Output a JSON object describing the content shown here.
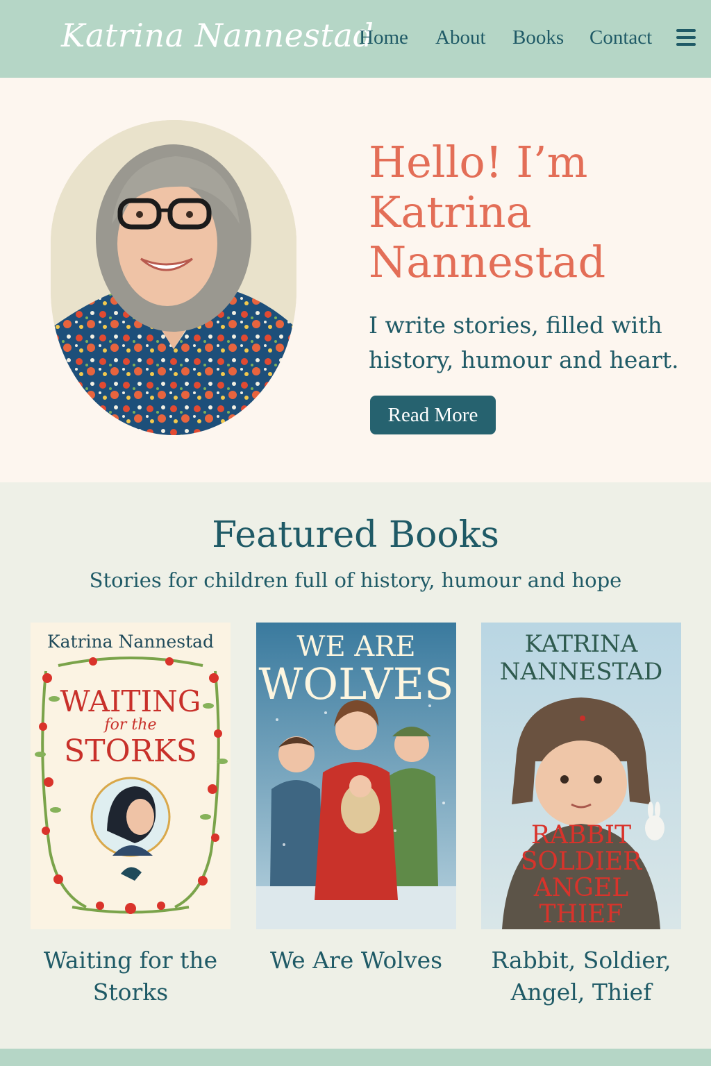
{
  "header": {
    "logo": "Katrina Nannestad",
    "nav": {
      "home": "Home",
      "about": "About",
      "books": "Books",
      "contact": "Contact"
    },
    "menu_icon": "hamburger-menu-icon"
  },
  "hero": {
    "title": "Hello! I’m Katrina Nannestad",
    "subtitle": "I write stories, filled with history, humour and heart.",
    "button_label": "Read More"
  },
  "featured": {
    "title": "Featured Books",
    "subtitle": "Stories for children full of history, humour and hope",
    "books": [
      {
        "caption": "Waiting for the Storks",
        "cover_author": "Katrina Nannestad",
        "cover_title_line1": "WAITING",
        "cover_title_line2": "for the",
        "cover_title_line3": "STORKS"
      },
      {
        "caption": "We Are Wolves",
        "cover_title_line1": "WE ARE",
        "cover_title_line2": "WOLVES"
      },
      {
        "caption": "Rabbit, Soldier, Angel, Thief",
        "cover_author_line1": "KATRINA",
        "cover_author_line2": "NANNESTAD",
        "cover_title_line1": "RABBIT",
        "cover_title_line2": "SOLDIER",
        "cover_title_line3": "ANGEL",
        "cover_title_line4": "THIEF"
      }
    ]
  },
  "colors": {
    "header_bg": "#b5d6c6",
    "accent": "#e36e57",
    "primary_text": "#1f5a66",
    "button_bg": "#26626f",
    "hero_bg": "#fdf6ef",
    "section_bg": "#eef0e7"
  }
}
